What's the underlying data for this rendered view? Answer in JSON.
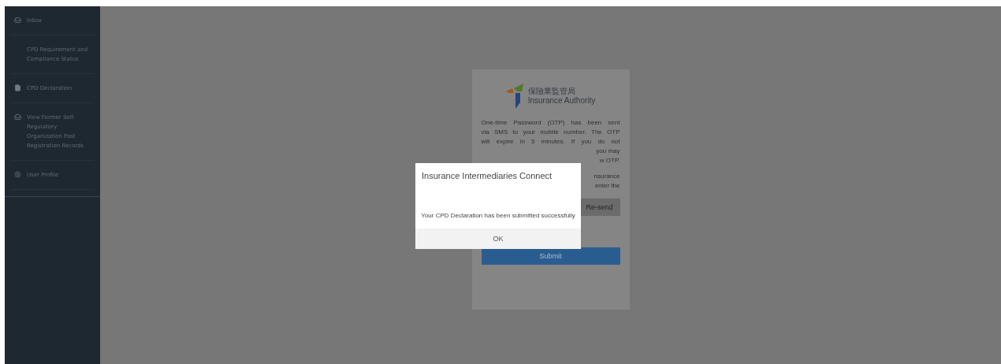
{
  "sidebar": {
    "items": [
      {
        "label": "Inbox",
        "kind": "inbox",
        "selected": false
      },
      {
        "label": "CPD Requirement and Compliance Status",
        "kind": "plain",
        "selected": false
      },
      {
        "label": "CPD Declaration",
        "kind": "file",
        "selected": false
      },
      {
        "label": "View Former Self-Regulatory Organization Past Registration Records",
        "kind": "inbox",
        "selected": false
      },
      {
        "label": "User Profile",
        "kind": "gear",
        "selected": false
      }
    ]
  },
  "card": {
    "logo": {
      "chinese": "保險業監管局",
      "english": "Insurance Authority"
    },
    "paragraph_lines": [
      {
        "text": "One-time Password (OTP) has been sent",
        "kind": "full"
      },
      {
        "text": "via SMS to your mobile number. The OTP",
        "kind": "full"
      },
      {
        "text": "will expire in 5 minutes. If you do not",
        "kind": "full"
      },
      {
        "text": "you may",
        "kind": "fragment"
      },
      {
        "text": "w OTP.",
        "kind": "fragment"
      },
      {
        "text": "nsurance",
        "kind": "gap"
      },
      {
        "text": "enter the",
        "kind": "fragment"
      }
    ],
    "resend_button": "Re-send",
    "submit_button": "Submit"
  },
  "dialog": {
    "title": "Insurance Intermediaries Connect",
    "message": "Your CPD Declaration has been submitted successfully",
    "ok_button": "OK"
  }
}
